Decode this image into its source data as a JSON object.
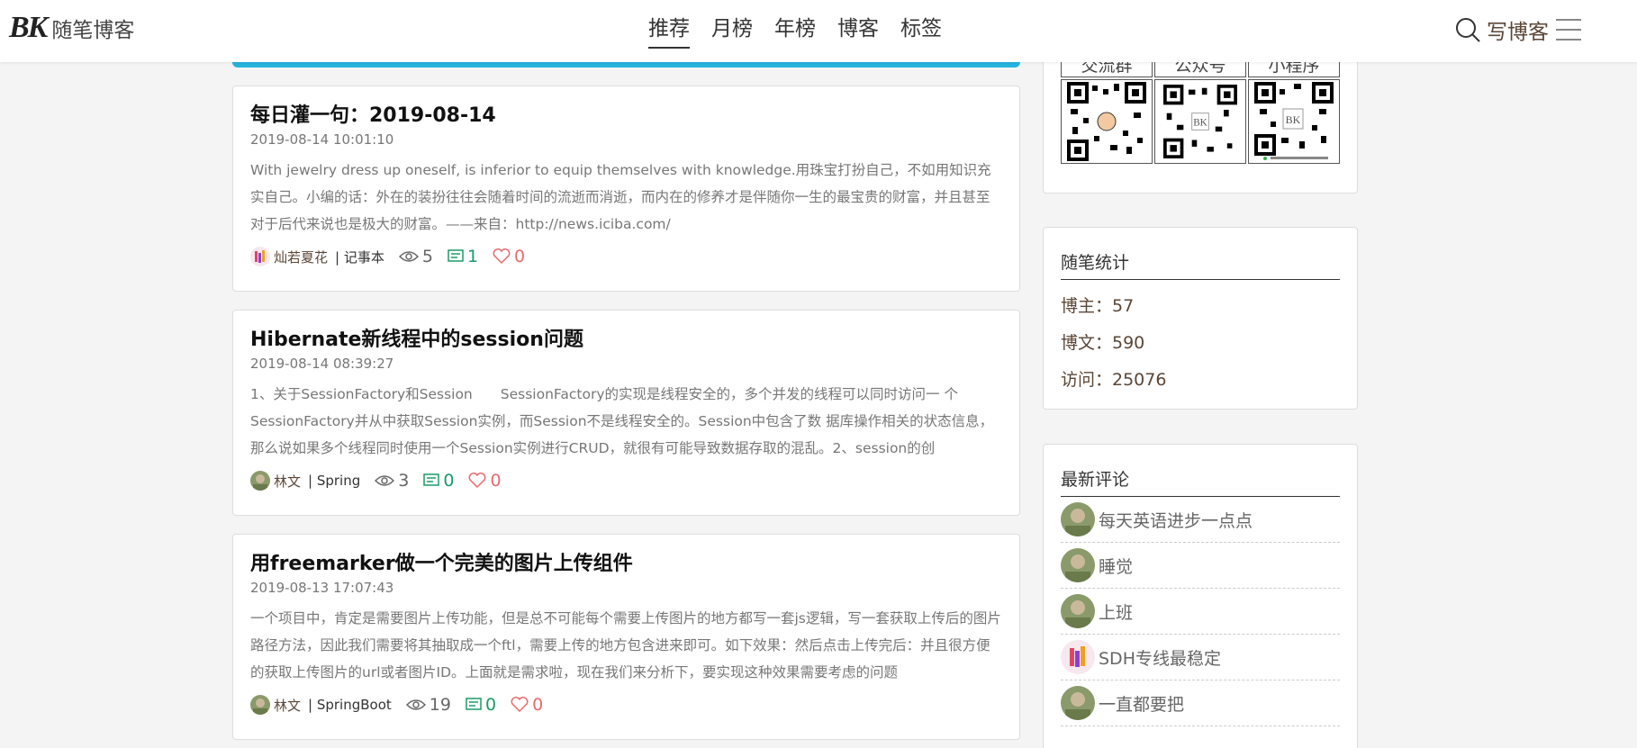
{
  "header": {
    "logo_mark": "BK",
    "site_name": "随笔博客",
    "nav": [
      "推荐",
      "月榜",
      "年榜",
      "博客",
      "标签"
    ],
    "nav_active": 0,
    "write_label": "写博客"
  },
  "posts": [
    {
      "title": "每日灌一句：2019-08-14",
      "date": "2019-08-14 10:01:10",
      "summary": "With jewelry dress up oneself, is inferior to equip themselves with knowledge.用珠宝打扮自己，不如用知识充实自己。小编的话：外在的装扮往往会随着时间的流逝而消逝，而内在的修养才是伴随你一生的最宝贵的财富，并且甚至对于后代来说也是极大的财富。——来自：http://news.iciba.com/",
      "author": "灿若夏花",
      "category": "| 记事本",
      "views": "5",
      "comments": "1",
      "likes": "0"
    },
    {
      "title": "Hibernate新线程中的session问题",
      "date": "2019-08-14 08:39:27",
      "summary": "1、关于SessionFactory和Session　　SessionFactory的实现是线程安全的，多个并发的线程可以同时访问一 个SessionFactory并从中获取Session实例，而Session不是线程安全的。Session中包含了数 据库操作相关的状态信息，那么说如果多个线程同时使用一个Session实例进行CRUD，就很有可能导致数据存取的混乱。2、session的创",
      "author": "林文",
      "category": "| Spring",
      "views": "3",
      "comments": "0",
      "likes": "0"
    },
    {
      "title": "用freemarker做一个完美的图片上传组件",
      "date": "2019-08-13 17:07:43",
      "summary": "一个项目中，肯定是需要图片上传功能，但是总不可能每个需要上传图片的地方都写一套js逻辑，写一套获取上传后的图片路径方法，因此我们需要将其抽取成一个ftl，需要上传的地方包含进来即可。如下效果：然后点击上传完后：并且很方便的获取上传图片的url或者图片ID。上面就是需求啦，现在我们来分析下，要实现这种效果需要考虑的问题",
      "author": "林文",
      "category": "| SpringBoot",
      "views": "19",
      "comments": "0",
      "likes": "0"
    }
  ],
  "sidebar": {
    "qr_labels": [
      "交流群",
      "公众号",
      "小程序"
    ],
    "stats": {
      "title": "随笔统计",
      "bloggers": "博主：57",
      "articles": "博文：590",
      "visits": "访问：25076"
    },
    "comments": {
      "title": "最新评论",
      "items": [
        "每天英语进步一点点",
        "睡觉",
        "上班",
        "SDH专线最稳定",
        "一直都要把"
      ]
    }
  },
  "colors": {
    "accent": "#25b4dd",
    "brown": "#5b4636",
    "comment_green": "#1a9a6a",
    "like_red": "#e76b6b"
  }
}
